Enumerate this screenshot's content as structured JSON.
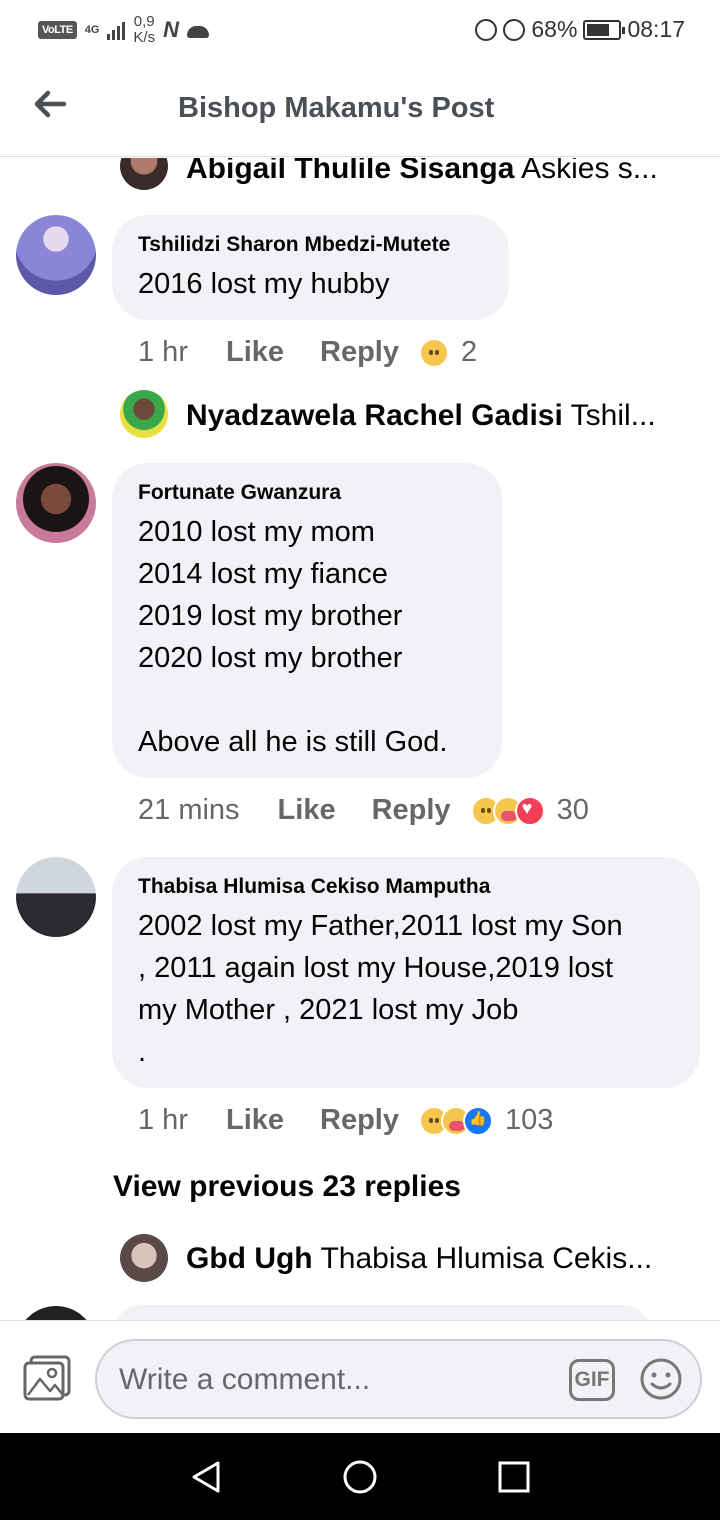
{
  "status_bar": {
    "volte": "VoLTE",
    "network": "4G",
    "speed_value": "0,9",
    "speed_unit": "K/s",
    "n_icon": "N",
    "battery": "68%",
    "time": "08:17"
  },
  "header": {
    "title": "Bishop Makamu's Post"
  },
  "replies": [
    {
      "name": "Abigail Thulile Sisanga",
      "snippet": "Askies s..."
    },
    {
      "name": "Nyadzawela Rachel Gadisi",
      "snippet": "Tshil..."
    },
    {
      "name": "Gbd Ugh",
      "snippet": "Thabisa Hlumisa Cekis..."
    }
  ],
  "comments": [
    {
      "name": "Tshilidzi Sharon Mbedzi-Mutete",
      "text": "2016 lost my hubby",
      "time": "1 hr",
      "like": "Like",
      "reply": "Reply",
      "reaction_count": "2"
    },
    {
      "name": "Fortunate Gwanzura",
      "text": "2010 lost my mom\n2014 lost my fiance\n2019 lost my brother\n2020 lost my brother\n\nAbove all he is still God.",
      "time": "21 mins",
      "like": "Like",
      "reply": "Reply",
      "reaction_count": "30"
    },
    {
      "name": "Thabisa Hlumisa Cekiso Mamputha",
      "text": "2002 lost my Father,2011 lost my Son\n, 2011 again lost my House,2019 lost\nmy Mother , 2021 lost my Job\n.",
      "time": "1 hr",
      "like": "Like",
      "reply": "Reply",
      "reaction_count": "103"
    }
  ],
  "view_previous": "View previous 23 replies",
  "composer": {
    "placeholder": "Write a comment...",
    "gif_label": "GIF"
  },
  "colors": {
    "bubble_bg": "#f0f2f5",
    "meta_text": "#65676b",
    "title_text": "#4b4f56"
  }
}
